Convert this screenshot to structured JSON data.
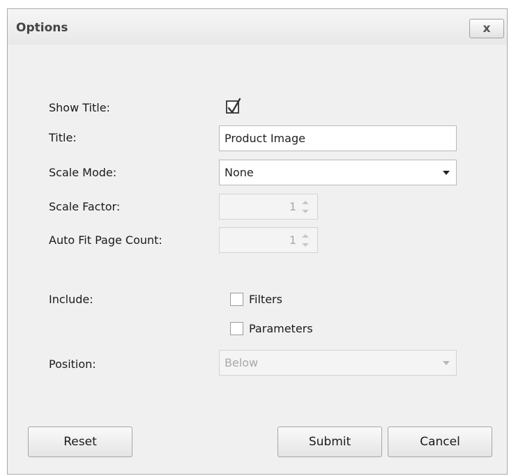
{
  "window": {
    "title": "Options",
    "close_label": "x"
  },
  "form": {
    "show_title_label": "Show Title:",
    "show_title_checked": true,
    "title_label": "Title:",
    "title_value": "Product Image",
    "scale_mode_label": "Scale Mode:",
    "scale_mode_value": "None",
    "scale_factor_label": "Scale Factor:",
    "scale_factor_value": "1",
    "auto_fit_label": "Auto Fit Page Count:",
    "auto_fit_value": "1",
    "include_label": "Include:",
    "include_filters_label": "Filters",
    "include_filters_checked": false,
    "include_parameters_label": "Parameters",
    "include_parameters_checked": false,
    "position_label": "Position:",
    "position_value": "Below"
  },
  "buttons": {
    "reset": "Reset",
    "submit": "Submit",
    "cancel": "Cancel"
  },
  "icons": {
    "close": "close-icon",
    "checkmark": "checkmark-icon",
    "dropdown": "chevron-down-icon",
    "spin_up": "spin-up-icon",
    "spin_down": "spin-down-icon"
  }
}
